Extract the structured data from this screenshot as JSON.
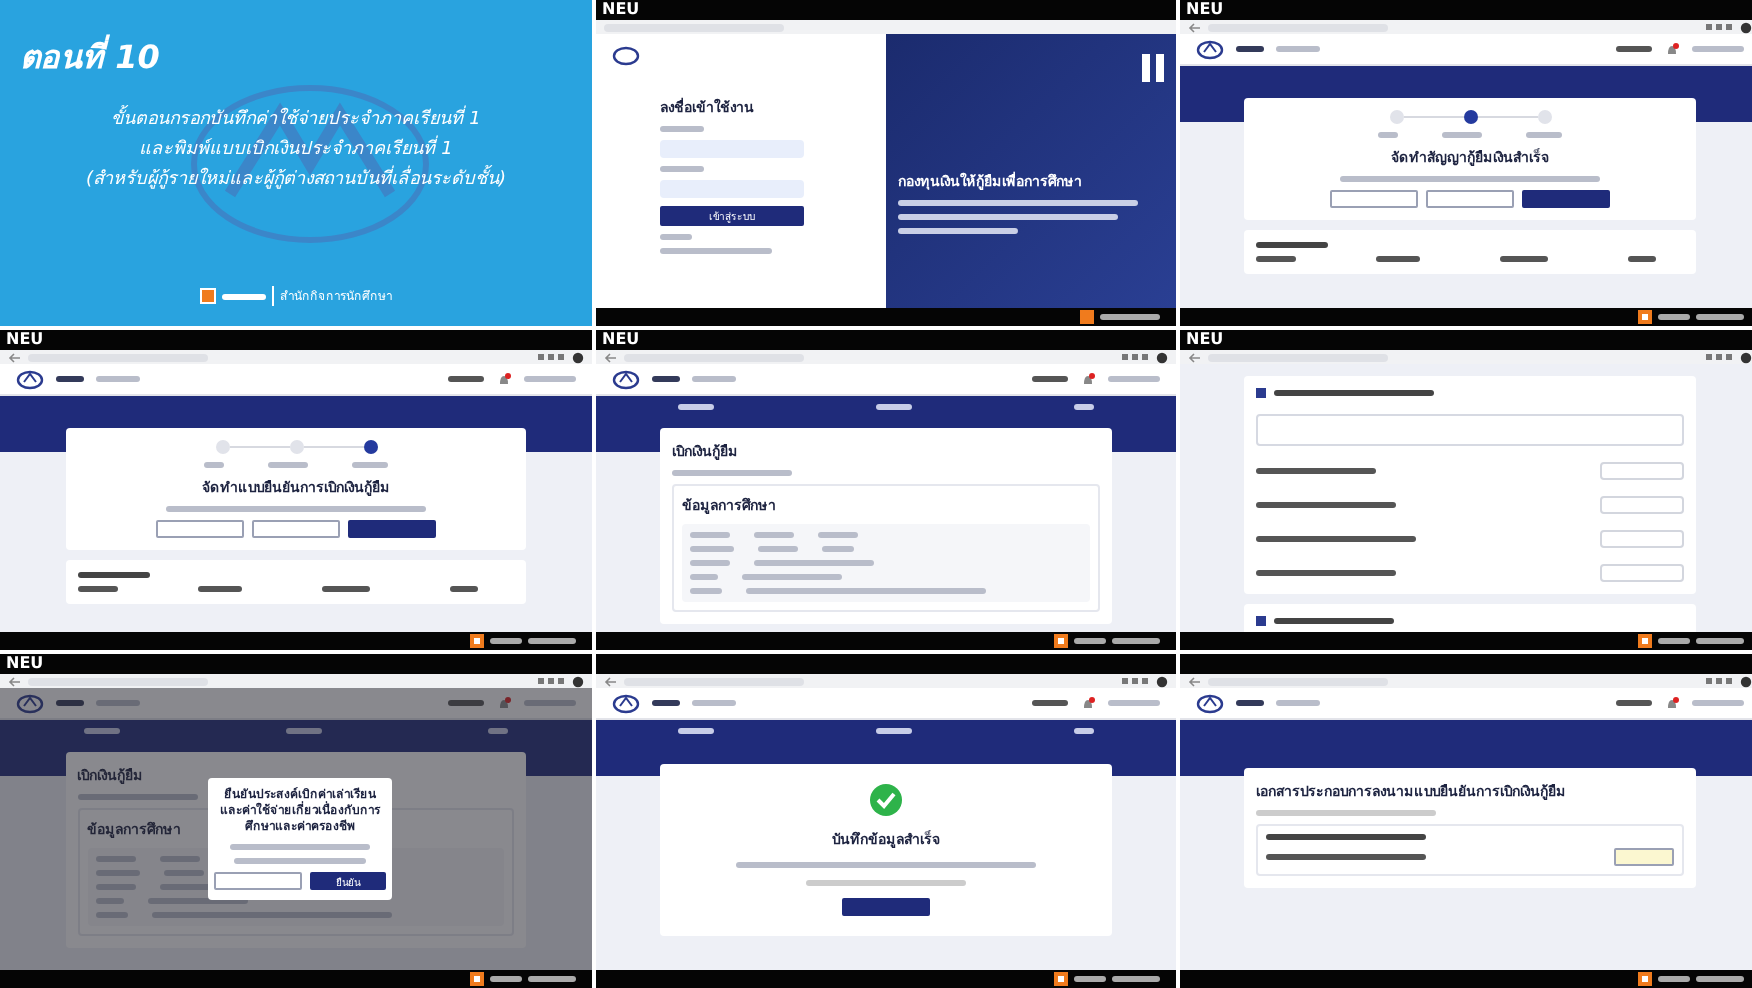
{
  "panels": [
    {
      "kind": "title",
      "episode": "ตอนที่ 10",
      "lines": [
        "ขั้นตอนกรอกบันทึกค่าใช้จ่ายประจำภาคเรียนที่ 1",
        "และพิมพ์แบบเบิกเงินประจำภาคเรียนที่ 1",
        "(สำหรับผู้กู้รายใหม่และผู้กู้ต่างสถานบันที่เลื่อนระดับชั้น)"
      ],
      "footer": "สำนักกิจการนักศึกษา"
    },
    {
      "kind": "login",
      "tag": "NEU",
      "form_title": "ลงชื่อเข้าใช้งาน",
      "button": "เข้าสู่ระบบ",
      "banner_title": "กองทุนเงินให้กู้ยืมเพื่อการศึกษา"
    },
    {
      "kind": "steps",
      "tag": "NEU",
      "heading": "จัดทำสัญญากู้ยืมเงินสำเร็จ",
      "steps": [
        {
          "selected": false
        },
        {
          "selected": true
        },
        {
          "selected": false
        }
      ]
    },
    {
      "kind": "steps",
      "tag": "NEU",
      "heading": "จัดทำแบบยืนยันการเบิกเงินกู้ยืม",
      "steps": [
        {
          "selected": false
        },
        {
          "selected": false
        },
        {
          "selected": true
        }
      ]
    },
    {
      "kind": "form",
      "tag": "NEU",
      "heading": "เบิกเงินกู้ยืม",
      "section": "ข้อมูลการศึกษา"
    },
    {
      "kind": "amounts",
      "tag": "NEU"
    },
    {
      "kind": "modal",
      "tag": "NEU",
      "heading": "เบิกเงินกู้ยืม",
      "section": "ข้อมูลการศึกษา",
      "modal_title": "ยืนยันประสงค์เบิกค่าเล่าเรียนและค่าใช้จ่ายเกี่ยวเนื่องกับการศึกษาและค่าครองชีพ",
      "confirm": "ยืนยัน"
    },
    {
      "kind": "success",
      "heading": "บันทึกข้อมูลสำเร็จ"
    },
    {
      "kind": "document",
      "heading": "เอกสารประกอบการลงนามแบบยืนยันการเบิกเงินกู้ยืม"
    }
  ]
}
